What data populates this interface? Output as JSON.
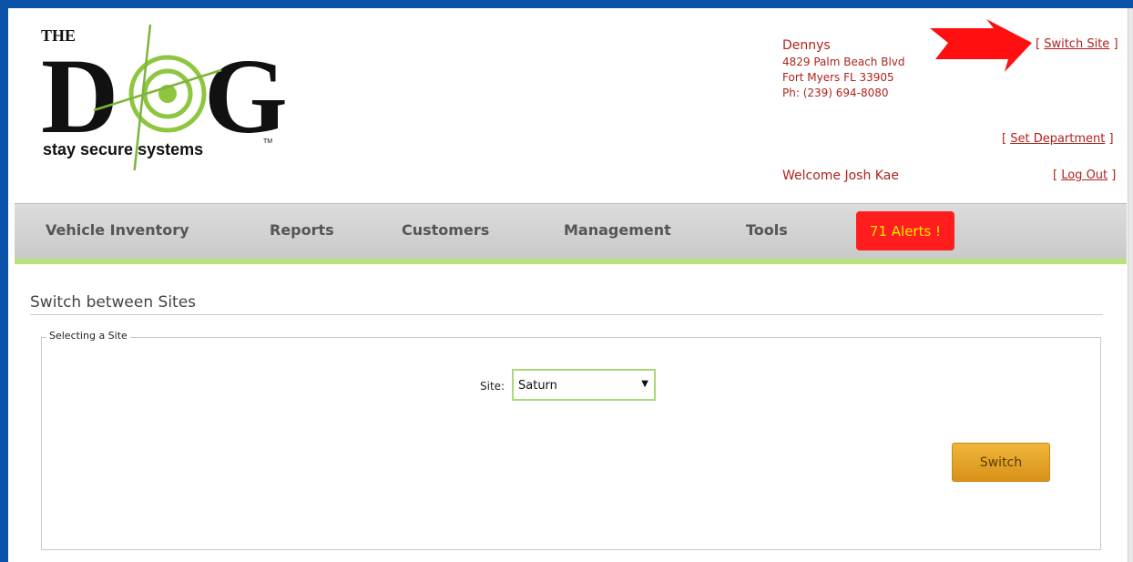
{
  "logo": {
    "the": "THE",
    "d": "D",
    "g": "G",
    "tagline": "stay secure systems",
    "tm": "TM"
  },
  "site_info": {
    "name": "Dennys",
    "address": "4829 Palm Beach Blvd",
    "city": "Fort Myers FL 33905",
    "phone": "Ph: (239) 694-8080"
  },
  "header_links": {
    "switch_site": "Switch Site",
    "set_department": "Set Department",
    "log_out": "Log Out",
    "open_bracket": "[",
    "close_bracket": "]"
  },
  "welcome": "Welcome Josh Kae",
  "nav": {
    "items": [
      "Vehicle Inventory",
      "Reports",
      "Customers",
      "Management",
      "Tools"
    ],
    "alerts": "71 Alerts !"
  },
  "content": {
    "title": "Switch between Sites",
    "legend": "Selecting a Site",
    "site_label": "Site:",
    "site_value": "Saturn",
    "switch_button": "Switch"
  },
  "colors": {
    "frame": "#0b53a8",
    "header_text": "#b0221c",
    "alert_bg": "#ff1d1d",
    "alert_text": "#ffe800",
    "nav_accent": "#b7e27a",
    "button": "#e6a42a"
  }
}
